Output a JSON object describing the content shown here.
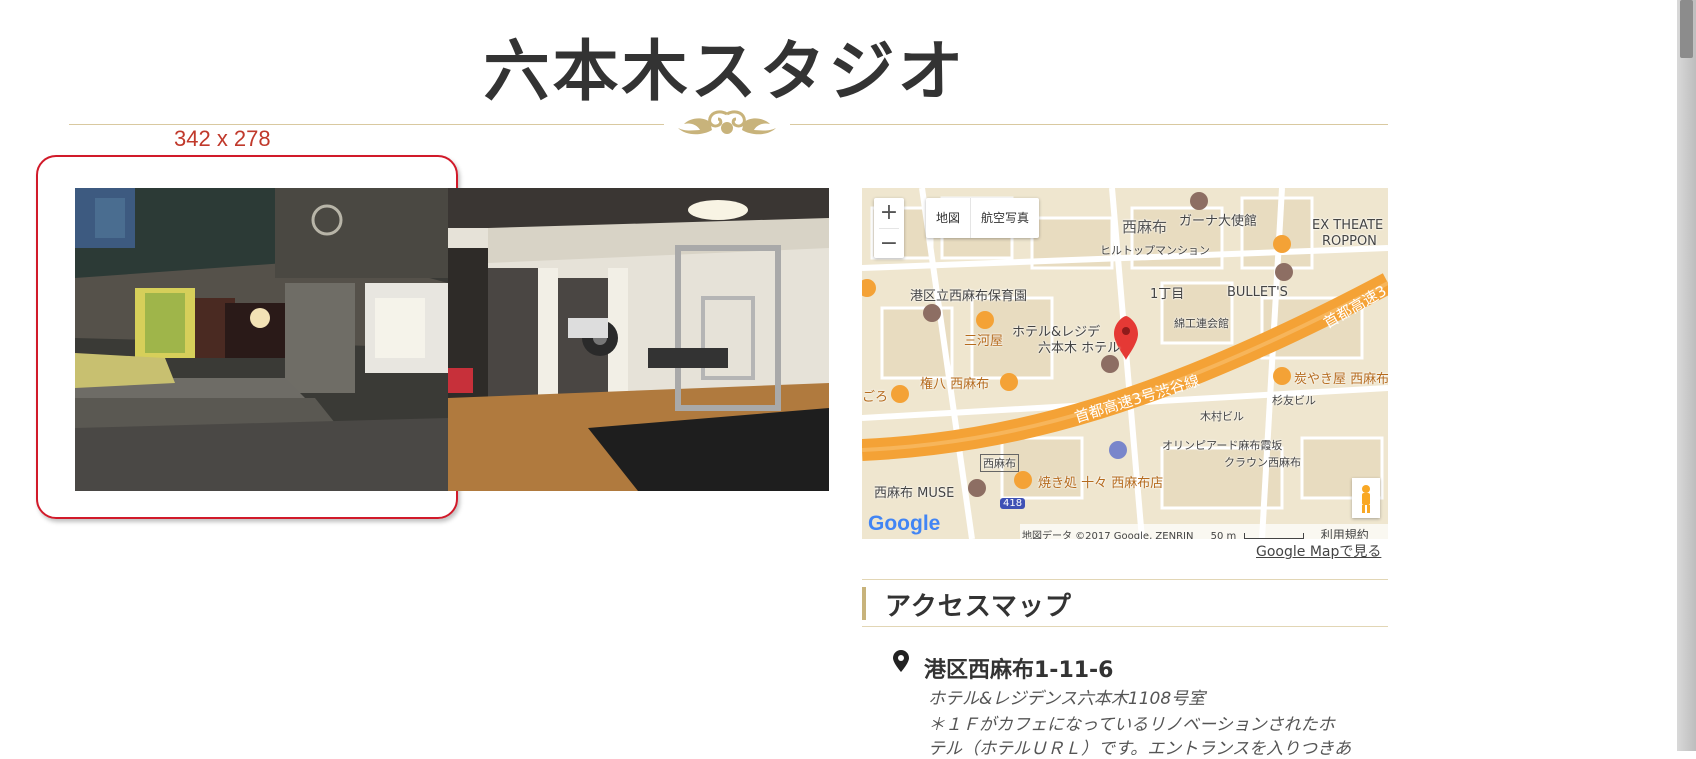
{
  "page": {
    "title": "六本木スタジオ",
    "dimension_label": "342 x 278"
  },
  "photos": [
    {
      "name": "entrance-photo",
      "description_icon": "building-entrance-image"
    },
    {
      "name": "gym-photo",
      "description_icon": "gym-interior-image"
    }
  ],
  "map": {
    "zoom_in": "+",
    "zoom_out": "−",
    "type_map": "地図",
    "type_satellite": "航空写真",
    "labels": [
      {
        "text": "西麻布",
        "cls": "big"
      },
      {
        "text": "ガーナ大使館",
        "cls": ""
      },
      {
        "text": "EX THEATE",
        "cls": ""
      },
      {
        "text": "ROPPON",
        "cls": ""
      },
      {
        "text": "ヒルトップマンション",
        "cls": ""
      },
      {
        "text": "港区立西麻布保育園",
        "cls": ""
      },
      {
        "text": "1丁目",
        "cls": ""
      },
      {
        "text": "BULLET'S",
        "cls": ""
      },
      {
        "text": "ホテル&レジデ",
        "cls": ""
      },
      {
        "text": "六本木 ホテル",
        "cls": ""
      },
      {
        "text": "三河屋",
        "cls": "orange"
      },
      {
        "text": "綿工連会館",
        "cls": ""
      },
      {
        "text": "首都高速3",
        "cls": "road"
      },
      {
        "text": "権八 西麻布",
        "cls": "orange"
      },
      {
        "text": "首都高速3号渋谷線",
        "cls": "road"
      },
      {
        "text": "炭やき屋 西麻布",
        "cls": "orange"
      },
      {
        "text": "ごろ",
        "cls": "orange"
      },
      {
        "text": "杉友ビル",
        "cls": ""
      },
      {
        "text": "木村ビル",
        "cls": ""
      },
      {
        "text": "オリンピアード麻布霞坂",
        "cls": ""
      },
      {
        "text": "西麻布",
        "cls": ""
      },
      {
        "text": "クラウン西麻布",
        "cls": ""
      },
      {
        "text": "焼き処 十々 西麻布店",
        "cls": "orange"
      },
      {
        "text": "西麻布 MUSE",
        "cls": ""
      },
      {
        "text": "418",
        "cls": ""
      }
    ],
    "google_logo": "Google",
    "footer_data": "地図データ ©2017 Google, ZENRIN",
    "footer_scale": "50 m",
    "footer_terms": "利用規約",
    "link_text": "Google Mapで見る"
  },
  "access": {
    "heading": "アクセスマップ",
    "address": "港区西麻布1-11-6",
    "note_line1": "ホテル&レジデンス六本木1108号室",
    "note_line2": "＊１Ｆがカフェになっているリノベーションされたホ",
    "note_line3": "テル（ホテルＵＲＬ）です。エントランスを入りつきあ"
  },
  "colors": {
    "accent_gold": "#c8b37b",
    "selection_red": "#d11a2a",
    "highway_orange": "#f4a236",
    "map_background": "#efe6cf"
  }
}
